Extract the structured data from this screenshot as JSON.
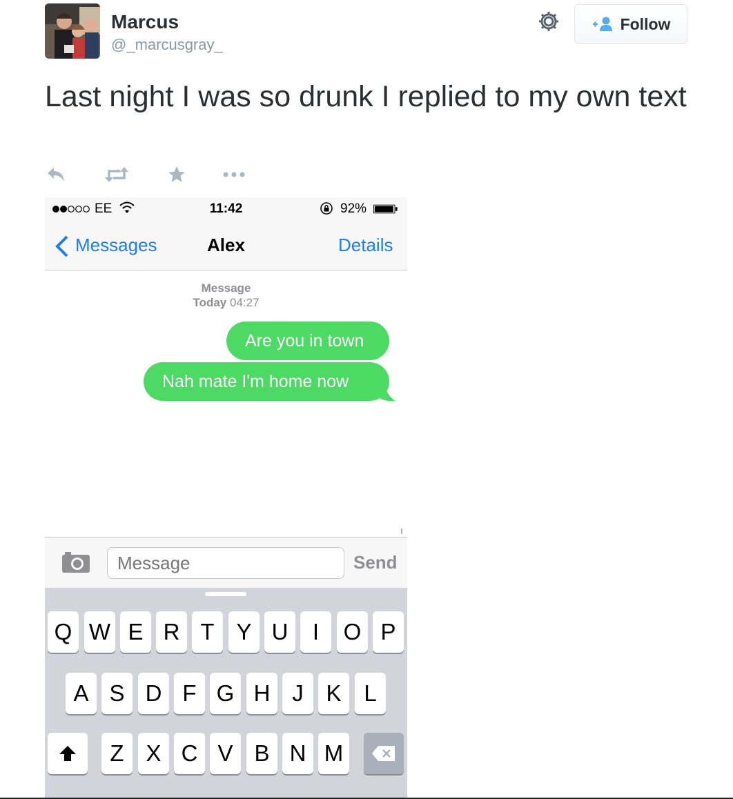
{
  "tweet": {
    "user_name": "Marcus",
    "user_handle": "@_marcusgray_",
    "follow_label": "Follow",
    "text": "Last night I was so drunk I replied to my own text",
    "actions": [
      "reply-icon",
      "retweet-icon",
      "favorite-icon",
      "more-icon"
    ]
  },
  "phone": {
    "status": {
      "carrier": "EE",
      "time": "11:42",
      "battery": "92%"
    },
    "nav": {
      "back_label": "Messages",
      "contact": "Alex",
      "details_label": "Details"
    },
    "timestamp": {
      "line1": "Message",
      "line2_day": "Today",
      "line2_time": "04:27"
    },
    "messages": [
      {
        "text": "Are you in town"
      },
      {
        "text": "Nah mate I'm home now"
      }
    ],
    "input": {
      "placeholder": "Message",
      "send_label": "Send"
    },
    "keyboard": {
      "row1": [
        "Q",
        "W",
        "E",
        "R",
        "T",
        "Y",
        "U",
        "I",
        "O",
        "P"
      ],
      "row2": [
        "A",
        "S",
        "D",
        "F",
        "G",
        "H",
        "J",
        "K",
        "L"
      ],
      "row3": [
        "Z",
        "X",
        "C",
        "V",
        "B",
        "N",
        "M"
      ]
    }
  },
  "colors": {
    "bubble": "#4cd964",
    "ios_blue": "#1c7cf4",
    "handle_gray": "#8899a6"
  }
}
